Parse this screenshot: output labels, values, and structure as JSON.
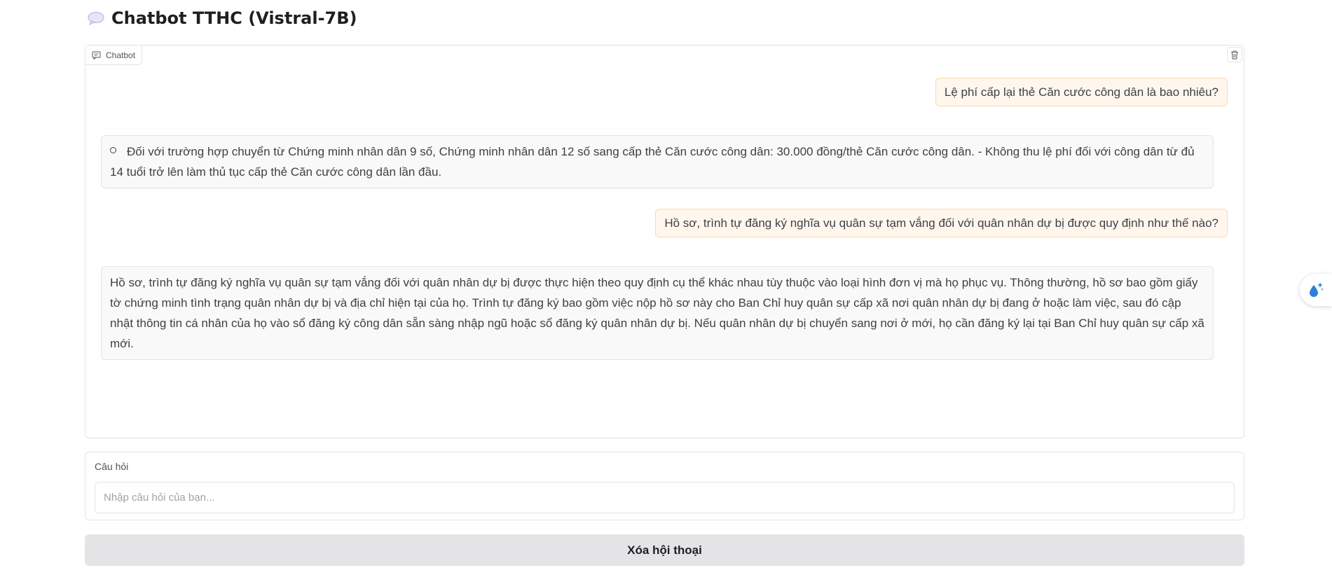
{
  "header": {
    "title": "Chatbot TTHC (Vistral-7B)",
    "icon": "speech-bubble-icon"
  },
  "chatbot": {
    "label": "Chatbot",
    "clear_icon": "trash-icon",
    "messages": [
      {
        "role": "user",
        "text": "Lệ phí cấp lại thẻ Căn cước công dân là bao nhiêu?"
      },
      {
        "role": "bot",
        "text": "Đối với trường hợp chuyển từ Chứng minh nhân dân 9 số, Chứng minh nhân dân 12 số sang cấp thẻ Căn cước công dân: 30.000 đồng/thẻ Căn cước công dân. - Không thu lệ phí đối với công dân từ đủ 14 tuổi trở lên làm thủ tục cấp thẻ Căn cước công dân lần đầu."
      },
      {
        "role": "user",
        "text": "Hồ sơ, trình tự đăng ký nghĩa vụ quân sự tạm vắng đối với quân nhân dự bị được quy định như thế nào?"
      },
      {
        "role": "bot",
        "text": "Hồ sơ, trình tự đăng ký nghĩa vụ quân sự tạm vắng đối với quân nhân dự bị được thực hiện theo quy định cụ thể khác nhau tùy thuộc vào loại hình đơn vị mà họ phục vụ. Thông thường, hồ sơ bao gồm giấy tờ chứng minh tình trạng quân nhân dự bị và địa chỉ hiện tại của họ. Trình tự đăng ký bao gồm việc nộp hồ sơ này cho Ban Chỉ huy quân sự cấp xã nơi quân nhân dự bị đang ở hoặc làm việc, sau đó cập nhật thông tin cá nhân của họ vào sổ đăng ký công dân sẵn sàng nhập ngũ hoặc sổ đăng ký quân nhân dự bị. Nếu quân nhân dự bị chuyển sang nơi ở mới, họ cần đăng ký lại tại Ban Chỉ huy quân sự cấp xã mới."
      }
    ]
  },
  "input": {
    "label": "Câu hỏi",
    "placeholder": "Nhập câu hỏi của bạn...",
    "value": ""
  },
  "clear_button": {
    "label": "Xóa hội thoại"
  },
  "floating_widget": {
    "icon": "water-drop-sparkle-icon"
  },
  "colors": {
    "user_bubble_bg": "#fff7ed",
    "user_bubble_border": "#fcd9b0",
    "bot_bubble_bg": "#f9f9f9",
    "button_bg": "#e4e4e7"
  }
}
